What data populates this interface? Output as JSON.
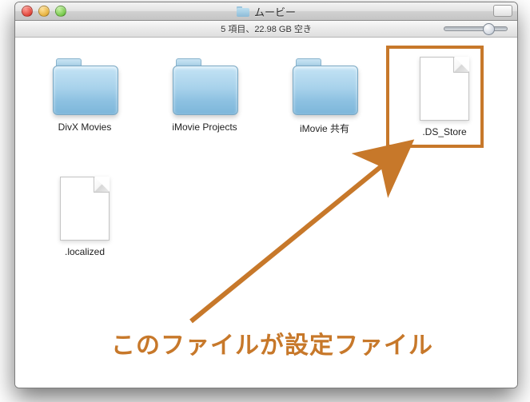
{
  "window": {
    "title": "ムービー",
    "status": "5 項目、22.98 GB 空き"
  },
  "items": [
    {
      "name": "DivX Movies",
      "kind": "folder"
    },
    {
      "name": "iMovie Projects",
      "kind": "folder"
    },
    {
      "name": "iMovie 共有",
      "kind": "folder"
    },
    {
      "name": ".DS_Store",
      "kind": "file"
    },
    {
      "name": ".localized",
      "kind": "file"
    }
  ],
  "annotation": {
    "text": "このファイルが設定ファイル",
    "highlight_target": ".DS_Store"
  },
  "colors": {
    "highlight": "#c7782a",
    "folder": "#a8d2eb"
  }
}
